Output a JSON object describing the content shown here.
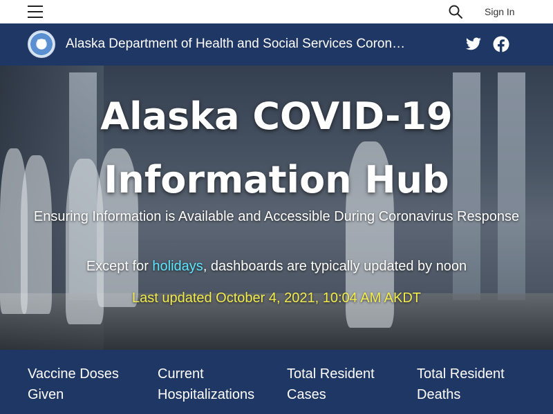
{
  "topbar": {
    "menu_icon": "hamburger-menu-icon",
    "search_icon": "search-icon",
    "sign_in_label": "Sign In"
  },
  "header": {
    "logo_icon": "alaska-dhss-seal",
    "title": "Alaska Department of Health and Social Services Coron…",
    "twitter_icon": "twitter-icon",
    "facebook_icon": "facebook-icon"
  },
  "hero": {
    "title_line1": "Alaska COVID-19",
    "title_line2": "Information Hub",
    "subtitle": "Ensuring Information is Available and Accessible During Coronavirus Response",
    "note_before": "Except for ",
    "note_link": "holidays",
    "note_after": ", dashboards are typically updated by noon",
    "last_updated": "Last updated October 4, 2021,  10:04 AM AKDT"
  },
  "stats": [
    {
      "line1": "Vaccine Doses",
      "line2": "Given"
    },
    {
      "line1": "Current",
      "line2": "Hospitalizations"
    },
    {
      "line1": "Total Resident",
      "line2": "Cases"
    },
    {
      "line1": "Total Resident",
      "line2": "Deaths"
    }
  ],
  "colors": {
    "header_bg": "#1f3764",
    "link_cyan": "#5ee6ff",
    "updated_yellow": "#f2ec4d"
  }
}
